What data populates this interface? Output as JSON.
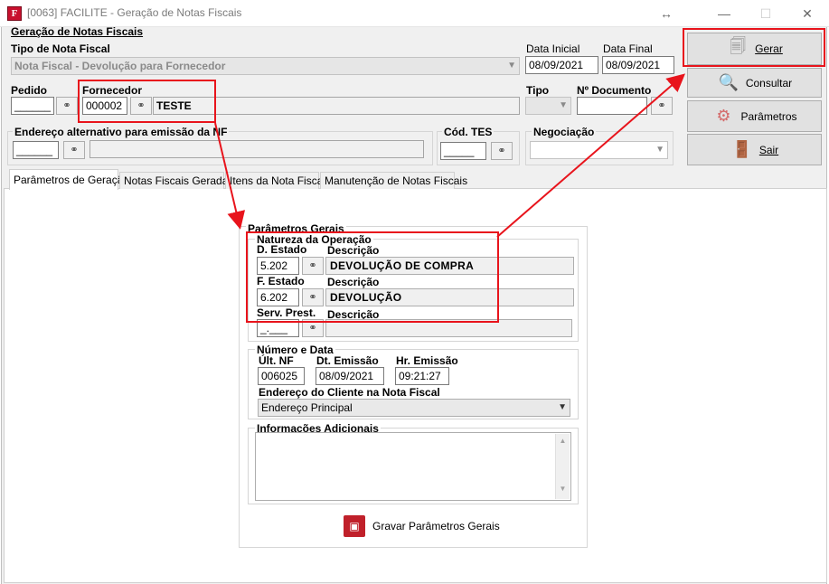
{
  "window": {
    "title": "[0063] FACILITE - Geração de Notas Fiscais",
    "icon_letter": "F"
  },
  "header": {
    "section_title": "Geração de Notas Fiscais",
    "tipo_nota_label": "Tipo de Nota Fiscal",
    "tipo_nota_value": "Nota Fiscal - Devolução para Fornecedor",
    "data_inicial_label": "Data Inicial",
    "data_inicial_value": "08/09/2021",
    "data_final_label": "Data Final",
    "data_final_value": "08/09/2021",
    "pedido_label": "Pedido",
    "pedido_value": "______",
    "fornecedor_label": "Fornecedor",
    "fornecedor_code": "000002",
    "fornecedor_name": "TESTE",
    "tipo_label": "Tipo",
    "n_documento_label": "Nº Documento",
    "endereco_alt_label": "Endereço alternativo para emissão da NF",
    "endereco_alt_code": "______",
    "cod_tes_label": "Cód. TES",
    "cod_tes_value": "_____",
    "negociacao_label": "Negociação"
  },
  "buttons": {
    "gerar": "Gerar",
    "consultar": "Consultar",
    "parametros": "Parâmetros",
    "sair": "Sair"
  },
  "tabs": [
    {
      "label": "Parâmetros de Geração"
    },
    {
      "label": "Notas Fiscais Geradas"
    },
    {
      "label": "Itens da Nota Fiscal"
    },
    {
      "label": "Manutenção de Notas Fiscais"
    }
  ],
  "parametros": {
    "title": "Parâmetros Gerais",
    "natureza_title": "Natureza da Operação",
    "d_estado_label": "D. Estado",
    "descricao_label": "Descrição",
    "d_estado_code": "5.202",
    "d_estado_desc": "DEVOLUÇÃO DE COMPRA",
    "f_estado_label": "F. Estado",
    "f_estado_code": "6.202",
    "f_estado_desc": "DEVOLUÇÃO",
    "serv_prest_label": "Serv. Prest.",
    "serv_prest_code": "_.___",
    "serv_prest_desc": "",
    "numero_title": "Número e Data",
    "ult_nf_label": "Últ. NF",
    "ult_nf_value": "006025",
    "dt_emissao_label": "Dt. Emissão",
    "dt_emissao_value": "08/09/2021",
    "hr_emissao_label": "Hr. Emissão",
    "hr_emissao_value": "09:21:27",
    "endereco_cliente_label": "Endereço do Cliente na Nota Fiscal",
    "endereco_cliente_value": "Endereço Principal",
    "info_adicionais_title": "Informações Adicionais",
    "info_adicionais_value": "",
    "gravar_label": "Gravar Parâmetros Gerais"
  },
  "colors": {
    "highlight": "#e8141c",
    "client_bg": "#f0f0f0"
  }
}
